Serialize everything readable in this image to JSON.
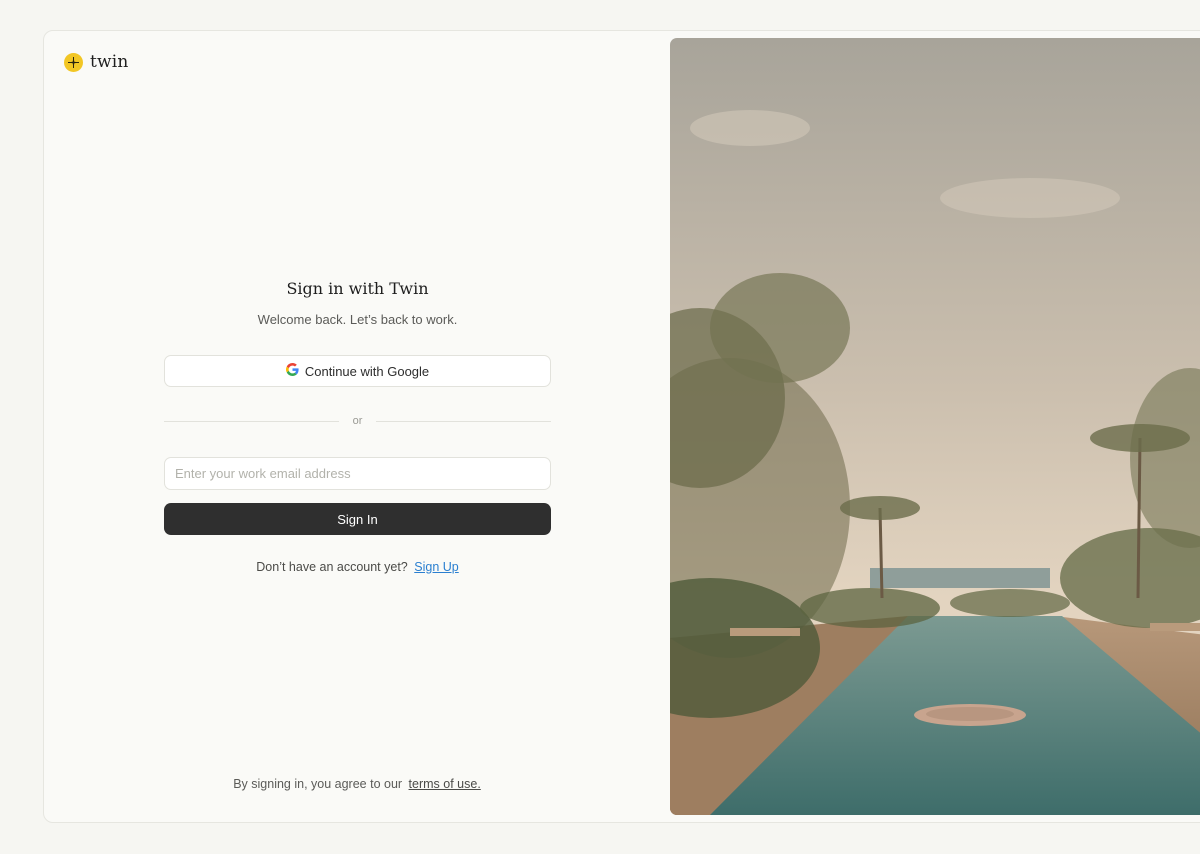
{
  "brand": {
    "name": "twin",
    "accent": "#f2c624"
  },
  "signin": {
    "title": "Sign in with Twin",
    "subtitle": "Welcome back. Let’s back to work.",
    "google_label": "Continue with Google",
    "divider_label": "or",
    "email_placeholder": "Enter your work email address",
    "email_value": "",
    "signin_label": "Sign In",
    "no_account_text": "Don’t have an account yet?",
    "signup_label": "Sign Up"
  },
  "footer": {
    "terms_text": "By signing in, you agree to our",
    "terms_link": "terms of use."
  },
  "icons": {
    "logo": "twin-logo-icon",
    "google": "google-icon"
  },
  "colors": {
    "page_bg": "#f6f6f2",
    "primary_button": "#2f2f2f",
    "link": "#2a7fd0"
  }
}
